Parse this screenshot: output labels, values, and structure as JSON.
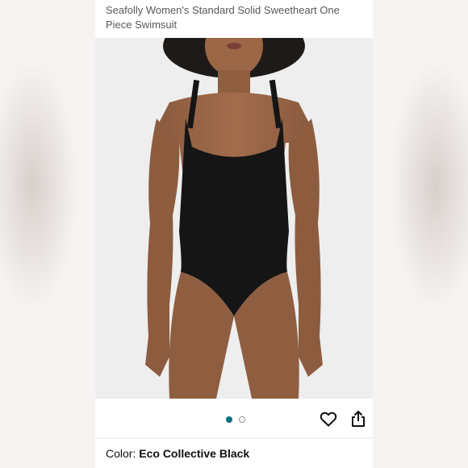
{
  "product": {
    "title": "Seafolly Women's Standard Solid Sweetheart One Piece Swimsuit"
  },
  "gallery": {
    "image_count": 2,
    "active_index": 0,
    "image_subject": "model-wearing-black-one-piece-swimsuit"
  },
  "actions": {
    "wishlist_icon": "heart-outline-icon",
    "share_icon": "share-icon"
  },
  "variant": {
    "color_label": "Color:",
    "color_value": "Eco Collective Black"
  },
  "colors": {
    "accent": "#007185",
    "text": "#0f1111",
    "muted_text": "#565959",
    "swimsuit": "#151515"
  }
}
